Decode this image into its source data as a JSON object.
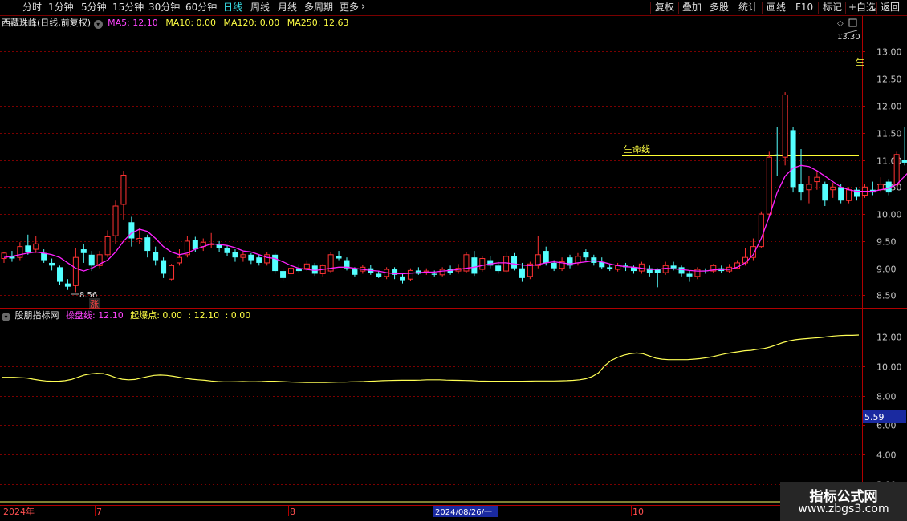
{
  "toolbar": {
    "periods": [
      {
        "label": "分时",
        "name": "period-fenshi"
      },
      {
        "label": "1分钟",
        "name": "period-1min"
      },
      {
        "label": "5分钟",
        "name": "period-5min"
      },
      {
        "label": "15分钟",
        "name": "period-15min"
      },
      {
        "label": "30分钟",
        "name": "period-30min"
      },
      {
        "label": "60分钟",
        "name": "period-60min"
      },
      {
        "label": "日线",
        "name": "period-daily"
      },
      {
        "label": "周线",
        "name": "period-weekly"
      },
      {
        "label": "月线",
        "name": "period-monthly"
      },
      {
        "label": "多周期",
        "name": "period-multi"
      },
      {
        "label": "更多",
        "name": "period-more"
      }
    ],
    "active_period": "日线",
    "more_arrow": "›",
    "right_buttons": [
      {
        "label": "复权",
        "name": "adjust-button"
      },
      {
        "label": "叠加",
        "name": "overlay-button"
      },
      {
        "label": "多股",
        "name": "multi-stock-button"
      },
      {
        "label": "统计",
        "name": "statistics-button"
      },
      {
        "label": "画线",
        "name": "draw-line-button"
      },
      {
        "label": "F10",
        "name": "f10-button"
      },
      {
        "label": "标记",
        "name": "mark-button"
      },
      {
        "label": "+自选",
        "name": "add-watchlist-button"
      },
      {
        "label": "返回",
        "name": "back-button"
      }
    ]
  },
  "main_panel": {
    "stock_title": "西藏珠峰(日线,前复权)",
    "ma5": "MA5: 12.10",
    "ma10": "MA10: 0.00",
    "ma120": "MA120: 0.00",
    "ma250": "MA250: 12.63",
    "high_label": "13.30",
    "low_label": "8.56",
    "lifeline_label": "生命线",
    "rise_label": "涨",
    "right_edge_label": "生",
    "y_ticks": [
      "13.00",
      "12.50",
      "12.00",
      "11.50",
      "11.00",
      "10.50",
      "10.00",
      "9.50",
      "9.00",
      "8.50"
    ]
  },
  "sub_panel": {
    "indicator_name": "股朋指标网",
    "line1_label": "操盘线: 12.10",
    "line2_label": "起爆点: 0.00",
    "extra1": ": 12.10",
    "extra2": ": 0.00",
    "y_ticks": [
      "12.00",
      "10.00",
      "8.00",
      "6.00",
      "4.00",
      "2.00"
    ],
    "current_value": "5.59"
  },
  "time_axis": {
    "labels": [
      {
        "text": "2024年",
        "name": "date-label-2024"
      },
      {
        "text": "7",
        "name": "date-label-jul"
      },
      {
        "text": "8",
        "name": "date-label-aug"
      },
      {
        "text": "2024/08/26/一",
        "name": "date-label-cursor"
      },
      {
        "text": "10",
        "name": "date-label-oct"
      }
    ]
  },
  "watermark": {
    "line1": "指标公式网",
    "line2": "www.zbgs3.com"
  },
  "colors": {
    "up": "#ff3232",
    "down": "#54ffff",
    "ma5": "#ff00ff",
    "lifeline": "#ffff00",
    "grid": "#7a0000",
    "axis_text": "#c8c8c8"
  },
  "chart_data": {
    "type": "candlestick",
    "price_range": [
      8.3,
      13.45
    ],
    "sub_range": [
      0.9,
      13.1
    ],
    "lifeline_value": 11.08,
    "candles": [
      [
        9.18,
        9.28,
        9.3,
        9.1
      ],
      [
        9.22,
        9.18,
        9.32,
        9.12
      ],
      [
        9.2,
        9.4,
        9.48,
        9.15
      ],
      [
        9.42,
        9.3,
        9.62,
        9.25
      ],
      [
        9.35,
        9.45,
        9.6,
        9.28
      ],
      [
        9.28,
        9.15,
        9.35,
        9.1
      ],
      [
        9.1,
        9.05,
        9.18,
        8.96
      ],
      [
        9.02,
        8.75,
        9.05,
        8.7
      ],
      [
        8.72,
        8.66,
        8.8,
        8.6
      ],
      [
        8.68,
        9.2,
        9.38,
        8.56
      ],
      [
        9.35,
        9.28,
        9.45,
        9.1
      ],
      [
        9.25,
        9.05,
        9.32,
        8.95
      ],
      [
        9.05,
        9.25,
        9.32,
        9.0
      ],
      [
        9.25,
        9.58,
        9.7,
        9.2
      ],
      [
        9.6,
        10.15,
        10.25,
        9.45
      ],
      [
        10.18,
        10.72,
        10.8,
        9.9
      ],
      [
        9.85,
        9.55,
        9.95,
        9.4
      ],
      [
        9.52,
        9.55,
        9.75,
        9.45
      ],
      [
        9.57,
        9.32,
        9.62,
        9.2
      ],
      [
        9.3,
        9.15,
        9.4,
        9.05
      ],
      [
        9.15,
        8.9,
        9.2,
        8.82
      ],
      [
        8.8,
        9.05,
        9.08,
        8.78
      ],
      [
        9.1,
        9.2,
        9.35,
        9.05
      ],
      [
        9.25,
        9.5,
        9.6,
        9.2
      ],
      [
        9.52,
        9.35,
        9.58,
        9.3
      ],
      [
        9.4,
        9.48,
        9.55,
        9.32
      ],
      [
        9.45,
        9.45,
        9.65,
        9.38
      ],
      [
        9.45,
        9.38,
        9.5,
        9.3
      ],
      [
        9.38,
        9.28,
        9.42,
        9.22
      ],
      [
        9.3,
        9.2,
        9.35,
        9.12
      ],
      [
        9.2,
        9.25,
        9.3,
        9.12
      ],
      [
        9.25,
        9.15,
        9.28,
        9.08
      ],
      [
        9.2,
        9.1,
        9.25,
        9.05
      ],
      [
        9.1,
        9.25,
        9.3,
        9.05
      ],
      [
        9.25,
        8.95,
        9.28,
        8.9
      ],
      [
        8.95,
        8.82,
        9.0,
        8.78
      ],
      [
        8.9,
        9.0,
        9.05,
        8.85
      ],
      [
        9.0,
        8.95,
        9.08,
        8.92
      ],
      [
        9.0,
        9.08,
        9.15,
        8.95
      ],
      [
        9.05,
        8.9,
        9.1,
        8.86
      ],
      [
        8.9,
        9.05,
        9.08,
        8.85
      ],
      [
        8.95,
        9.25,
        9.3,
        8.92
      ],
      [
        9.22,
        9.18,
        9.32,
        9.15
      ],
      [
        9.15,
        9.0,
        9.2,
        8.96
      ],
      [
        8.98,
        8.88,
        9.02,
        8.85
      ],
      [
        8.95,
        9.02,
        9.06,
        8.9
      ],
      [
        9.0,
        8.92,
        9.06,
        8.88
      ],
      [
        8.9,
        8.84,
        8.95,
        8.82
      ],
      [
        8.85,
        8.98,
        9.02,
        8.8
      ],
      [
        8.98,
        8.88,
        9.02,
        8.8
      ],
      [
        8.85,
        8.78,
        8.9,
        8.72
      ],
      [
        8.8,
        8.96,
        9.0,
        8.76
      ],
      [
        8.96,
        8.9,
        9.02,
        8.88
      ],
      [
        8.92,
        8.95,
        9.0,
        8.88
      ],
      [
        8.9,
        8.88,
        8.96,
        8.85
      ],
      [
        8.88,
        8.98,
        9.02,
        8.85
      ],
      [
        8.98,
        8.92,
        9.05,
        8.88
      ],
      [
        8.95,
        9.0,
        9.08,
        8.9
      ],
      [
        8.95,
        9.25,
        9.3,
        8.92
      ],
      [
        9.2,
        8.9,
        9.32,
        8.86
      ],
      [
        8.98,
        9.18,
        9.22,
        8.94
      ],
      [
        9.15,
        9.05,
        9.22,
        9.0
      ],
      [
        9.05,
        8.95,
        9.12,
        8.9
      ],
      [
        8.95,
        9.22,
        9.3,
        8.92
      ],
      [
        9.22,
        9.0,
        9.28,
        8.96
      ],
      [
        9.0,
        8.82,
        9.1,
        8.75
      ],
      [
        8.85,
        9.08,
        9.12,
        8.8
      ],
      [
        9.05,
        9.25,
        9.6,
        9.0
      ],
      [
        9.32,
        9.1,
        9.4,
        9.05
      ],
      [
        9.1,
        9.0,
        9.15,
        8.95
      ],
      [
        9.0,
        9.12,
        9.2,
        8.95
      ],
      [
        9.2,
        9.05,
        9.25,
        9.0
      ],
      [
        9.1,
        9.22,
        9.28,
        9.05
      ],
      [
        9.3,
        9.2,
        9.35,
        9.15
      ],
      [
        9.2,
        9.1,
        9.25,
        9.05
      ],
      [
        9.12,
        9.02,
        9.2,
        8.98
      ],
      [
        9.02,
        8.98,
        9.08,
        8.95
      ],
      [
        8.98,
        9.05,
        9.1,
        8.94
      ],
      [
        9.05,
        9.02,
        9.1,
        8.95
      ],
      [
        9.02,
        8.95,
        9.05,
        8.9
      ],
      [
        8.95,
        9.08,
        9.12,
        8.9
      ],
      [
        9.0,
        8.92,
        9.05,
        8.85
      ],
      [
        8.98,
        8.92,
        9.0,
        8.65
      ],
      [
        8.92,
        9.05,
        9.12,
        8.88
      ],
      [
        9.05,
        9.0,
        9.12,
        8.96
      ],
      [
        9.02,
        8.9,
        9.05,
        8.85
      ],
      [
        8.9,
        8.85,
        8.96,
        8.75
      ],
      [
        8.85,
        8.98,
        9.02,
        8.8
      ],
      [
        8.96,
        8.95,
        9.0,
        8.9
      ],
      [
        8.95,
        9.05,
        9.08,
        8.92
      ],
      [
        9.0,
        8.95,
        9.05,
        8.92
      ],
      [
        8.95,
        9.02,
        9.08,
        8.92
      ],
      [
        9.0,
        9.1,
        9.15,
        8.98
      ],
      [
        9.1,
        9.2,
        9.38,
        9.05
      ],
      [
        9.2,
        9.4,
        9.55,
        9.15
      ],
      [
        9.4,
        10.0,
        10.05,
        9.38
      ],
      [
        10.0,
        11.05,
        11.15,
        9.95
      ],
      [
        11.1,
        11.08,
        11.6,
        10.7
      ],
      [
        11.05,
        12.2,
        12.25,
        10.9
      ],
      [
        11.55,
        10.5,
        11.6,
        10.4
      ],
      [
        10.55,
        10.4,
        11.2,
        10.25
      ],
      [
        10.45,
        10.55,
        10.7,
        10.2
      ],
      [
        10.6,
        10.68,
        10.8,
        10.45
      ],
      [
        10.55,
        10.25,
        10.6,
        10.15
      ],
      [
        10.45,
        10.5,
        10.58,
        10.3
      ],
      [
        10.5,
        10.25,
        10.55,
        10.2
      ],
      [
        10.25,
        10.45,
        10.5,
        10.2
      ],
      [
        10.45,
        10.32,
        10.5,
        10.25
      ],
      [
        10.35,
        10.5,
        10.55,
        10.3
      ],
      [
        10.45,
        10.4,
        10.6,
        10.35
      ],
      [
        10.45,
        10.55,
        10.68,
        10.4
      ],
      [
        10.6,
        10.4,
        10.65,
        10.35
      ],
      [
        10.55,
        11.1,
        11.15,
        10.5
      ],
      [
        11.0,
        10.95,
        11.6,
        10.9
      ],
      [
        11.15,
        10.9,
        11.2,
        10.85
      ],
      [
        10.95,
        11.1,
        11.15,
        10.88
      ],
      [
        11.1,
        11.4,
        11.6,
        11.0
      ],
      [
        11.45,
        11.3,
        11.5,
        11.2
      ],
      [
        11.55,
        11.95,
        12.05,
        11.5
      ],
      [
        12.0,
        12.05,
        12.35,
        11.95
      ],
      [
        12.0,
        11.85,
        12.15,
        11.7
      ],
      [
        11.9,
        12.1,
        12.3,
        11.85
      ],
      [
        12.15,
        12.25,
        12.45,
        12.1
      ],
      [
        12.05,
        12.15,
        12.25,
        12.0
      ],
      [
        12.1,
        12.6,
        13.3,
        12.05
      ]
    ],
    "ma5": [
      9.2,
      9.22,
      9.25,
      9.28,
      9.3,
      9.28,
      9.25,
      9.2,
      9.1,
      9.0,
      8.95,
      9.0,
      9.08,
      9.15,
      9.3,
      9.5,
      9.65,
      9.72,
      9.68,
      9.55,
      9.4,
      9.3,
      9.25,
      9.28,
      9.35,
      9.4,
      9.45,
      9.44,
      9.42,
      9.38,
      9.32,
      9.3,
      9.25,
      9.2,
      9.18,
      9.12,
      9.05,
      9.0,
      8.98,
      8.96,
      8.98,
      9.0,
      9.02,
      9.02,
      9.0,
      8.98,
      8.96,
      8.95,
      8.92,
      8.9,
      8.9,
      8.91,
      8.92,
      8.93,
      8.93,
      8.95,
      8.96,
      8.98,
      9.0,
      9.02,
      9.05,
      9.08,
      9.1,
      9.1,
      9.08,
      9.06,
      9.05,
      9.07,
      9.1,
      9.12,
      9.1,
      9.08,
      9.1,
      9.12,
      9.14,
      9.12,
      9.08,
      9.05,
      9.03,
      9.02,
      9.0,
      8.98,
      8.98,
      9.0,
      8.99,
      8.98,
      8.96,
      8.95,
      8.95,
      8.97,
      8.98,
      8.98,
      9.02,
      9.1,
      9.25,
      9.55,
      9.95,
      10.4,
      10.7,
      10.85,
      10.9,
      10.88,
      10.8,
      10.7,
      10.6,
      10.5,
      10.45,
      10.42,
      10.42,
      10.42,
      10.45,
      10.48,
      10.55,
      10.7,
      10.85,
      10.95,
      11.05,
      11.15,
      11.35,
      11.55,
      11.7,
      11.82,
      11.92,
      11.98,
      12.02,
      12.1
    ],
    "sub_line": [
      9.25,
      9.25,
      9.25,
      9.22,
      9.2,
      9.12,
      9.05,
      9.0,
      8.98,
      8.98,
      9.02,
      9.1,
      9.25,
      9.4,
      9.48,
      9.52,
      9.5,
      9.38,
      9.22,
      9.12,
      9.08,
      9.1,
      9.2,
      9.3,
      9.38,
      9.4,
      9.38,
      9.32,
      9.25,
      9.18,
      9.12,
      9.08,
      9.05,
      9.0,
      8.96,
      8.94,
      8.94,
      8.95,
      8.96,
      8.95,
      8.95,
      8.96,
      8.98,
      8.98,
      8.96,
      8.94,
      8.92,
      8.91,
      8.9,
      8.9,
      8.9,
      8.9,
      8.91,
      8.92,
      8.92,
      8.94,
      8.95,
      8.96,
      8.98,
      9.0,
      9.02,
      9.03,
      9.04,
      9.05,
      9.05,
      9.05,
      9.06,
      9.08,
      9.08,
      9.08,
      9.06,
      9.05,
      9.04,
      9.03,
      9.02,
      9.0,
      8.99,
      8.98,
      8.98,
      8.98,
      8.98,
      8.98,
      8.98,
      8.99,
      9.0,
      9.0,
      9.0,
      9.0,
      9.01,
      9.02,
      9.04,
      9.08,
      9.15,
      9.3,
      9.55,
      10.05,
      10.4,
      10.6,
      10.75,
      10.85,
      10.9,
      10.85,
      10.7,
      10.55,
      10.48,
      10.45,
      10.45,
      10.45,
      10.45,
      10.48,
      10.52,
      10.58,
      10.65,
      10.75,
      10.85,
      10.92,
      10.98,
      11.05,
      11.08,
      11.15,
      11.2,
      11.3,
      11.45,
      11.6,
      11.72,
      11.8,
      11.85,
      11.88,
      11.92,
      11.95,
      12.0,
      12.05,
      12.08,
      12.1,
      12.1,
      12.12
    ]
  }
}
